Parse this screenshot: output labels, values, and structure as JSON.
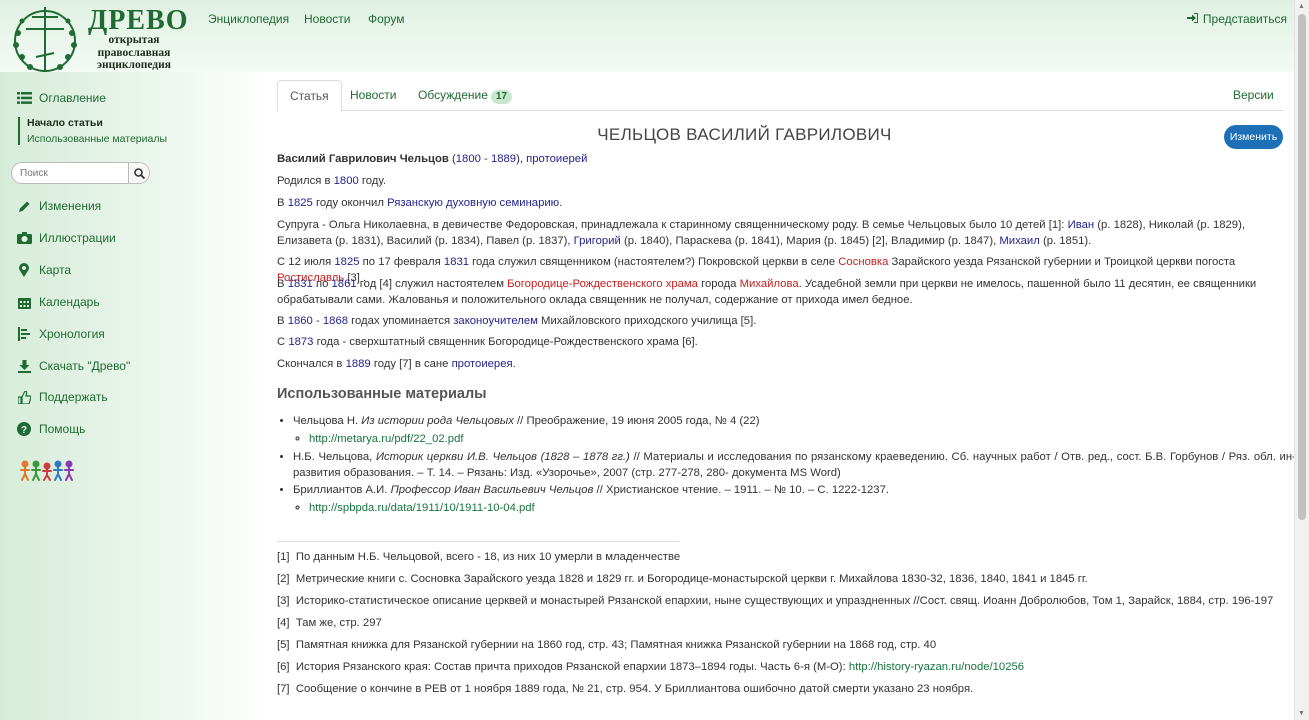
{
  "logo": {
    "title": "ДРЕВО",
    "subtitle_lines": [
      "открытая",
      "православная",
      "энциклопедия"
    ]
  },
  "nav": {
    "encyclopedia": "Энциклопедия",
    "news": "Новости",
    "forum": "Форум",
    "login": "Представиться"
  },
  "sidebar": {
    "toc": "Оглавление",
    "toc_items": [
      "Начало статьи",
      "Использованные материалы"
    ],
    "search_placeholder": "Поиск",
    "items": [
      "Изменения",
      "Иллюстрации",
      "Карта",
      "Календарь",
      "Хронология",
      "Скачать \"Древо\"",
      "Поддержать",
      "Помощь"
    ]
  },
  "tabs": {
    "article": "Статья",
    "news": "Новости",
    "discussion": "Обсуждение",
    "discussion_count": "17",
    "versions": "Версии"
  },
  "title": "ЧЕЛЬЦОВ ВАСИЛИЙ ГАВРИЛОВИЧ",
  "edit_label": "Изменить",
  "article": {
    "p1": {
      "name": "Василий Гаврилович Чельцов",
      "open": " (",
      "y1": "1800",
      "dash": " - ",
      "y2": "1889",
      "close": "), ",
      "rank": "протоиерей"
    },
    "p2": {
      "a": "Родился в ",
      "year": "1800",
      "b": " году."
    },
    "p3": {
      "a": "В ",
      "year": "1825",
      "b": " году окончил ",
      "sem": "Рязанскую духовную семинарию",
      "c": "."
    },
    "p4": {
      "a": "Супруга - Ольга Николаевна, в девичестве Федоровская, принадлежала к старинному священническому роду. В семье Чельцовых было 10 детей [1]: ",
      "ivan": "Иван",
      "b": " (р. 1828), Николай (р. 1829), Елизавета (р. 1831), Василий (р. 1834), Павел (р. 1837), ",
      "grigoriy": "Григорий",
      "c": " (р. 1840), Параскева (р. 1841), Мария (р. 1845) [2], Владимир (р. 1847), ",
      "mikhail": "Михаил",
      "d": " (р. 1851)."
    },
    "p5": {
      "a": "С 12 июля ",
      "y1": "1825",
      "b": " по 17 февраля ",
      "y2": "1831",
      "c": " года служил священником (настоятелем?) Покровской церкви в селе ",
      "sosnovka": "Сосновка",
      "d": " Зарайского уезда Рязанской губернии и Троицкой церкви погоста ",
      "rostislavl": "Ростиславль",
      "e": " [3] ."
    },
    "p6": {
      "a": "В ",
      "y1": "1831",
      "b": " по ",
      "y2": "1861",
      "c": " год [4] служил настоятелем ",
      "church": "Богородице-Рождественского храма",
      "d": " города ",
      "city": "Михайлова",
      "e": ". Усадебной земли при церкви не имелось, пашенной было 11 десятин, ее священники обрабатывали сами. Жалованья и положительного оклада священник не получал, содержание от прихода имел бедное."
    },
    "p7": {
      "a": "В ",
      "y1": "1860",
      "dash": " - ",
      "y2": "1868",
      "b": " годах упоминается ",
      "teacher": "законоучителем",
      "c": " Михайловского приходского училища [5]."
    },
    "p8": {
      "a": "С ",
      "y": "1873",
      "b": " года - сверхштатный священник Богородице-Рождественского храма [6]."
    },
    "p9": {
      "a": "Скончался в ",
      "y": "1889",
      "b": " году [7] в сане ",
      "rank": "протоиерея",
      "c": "."
    }
  },
  "materials": {
    "heading": "Использованные материалы",
    "r1": {
      "a": "Чельцова Н. ",
      "i": "Из истории рода Чельцовых",
      "b": " // Преображение, 19 июня 2005 года, № 4 (22)",
      "url": "http://metarya.ru/pdf/22_02.pdf"
    },
    "r2": {
      "a": "Н.Б. Чельцова, ",
      "i": "Историк церкви И.В. Чельцов (1828 – 1878 гг.)",
      "b": " // Материалы и исследования по рязанскому краеведению. Сб. научных работ / Отв. ред., сост. Б.В. Горбунов / Ряз. обл. ин-т развития образования. – Т. 14. – Рязань: Изд. «Узорочье», 2007 (стр. 277-278, 280- документа MS Word)"
    },
    "r3": {
      "a": "Бриллиантов А.И. ",
      "i": "Профессор Иван Васильевич Чельцов",
      "b": " // Христианское чтение. – 1911. – № 10. – С. 1222-1237.",
      "url": "http://spbpda.ru/data/1911/10/1911-10-04.pdf"
    }
  },
  "footnotes": [
    {
      "n": "[1]",
      "text": "По данным Н.Б. Чельцовой, всего - 18, из них 10 умерли в младенчестве"
    },
    {
      "n": "[2]",
      "text": "Метрические книги с. Сосновка Зарайского уезда 1828 и 1829 гг. и Богородице-монастырской церкви г. Михайлова 1830-32, 1836, 1840, 1841 и 1845 гг."
    },
    {
      "n": "[3]",
      "text": "Историко-статистическое описание церквей и монастырей Рязанской епархии, ныне существующих и упраздненных //Сост. свящ. Иоанн Добролюбов, Том 1, Зарайск, 1884, стр. 196-197"
    },
    {
      "n": "[4]",
      "text": "Там же, стр. 297"
    },
    {
      "n": "[5]",
      "text": "Памятная книжка для Рязанской губернии на 1860 год, стр. 43; Памятная книжка Рязанской губернии на 1868 год, стр. 40"
    },
    {
      "n": "[6]",
      "text": "История Рязанского края: Состав причта приходов Рязанской епархии 1873–1894 годы. Часть 6-я (М-О): ",
      "url": "http://history-ryazan.ru/node/10256"
    },
    {
      "n": "[7]",
      "text": "Сообщение о кончине в РЕВ от 1 ноября 1889 года, № 21, стр. 954. У Бриллиантова ошибочно датой смерти указано 23 ноября."
    }
  ]
}
